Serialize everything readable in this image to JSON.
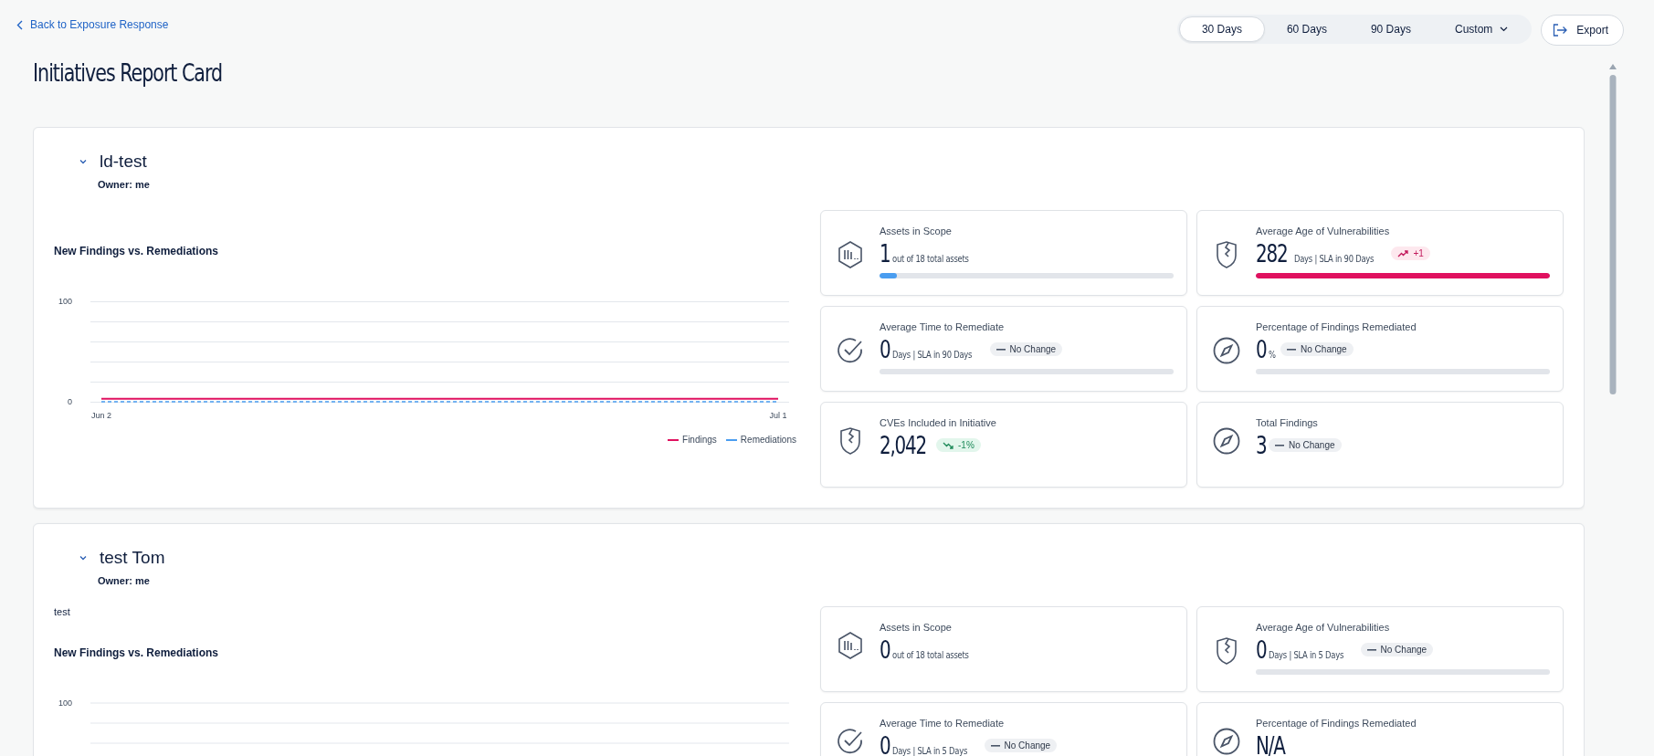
{
  "back_link": "Back to Exposure Response",
  "range_tabs": [
    {
      "label": "30 Days",
      "selected": true
    },
    {
      "label": "60 Days",
      "selected": false
    },
    {
      "label": "90 Days",
      "selected": false
    },
    {
      "label": "Custom",
      "selected": false,
      "kind": "dropdown"
    }
  ],
  "export_button": "Export",
  "title": "Initiatives Report Card",
  "initiatives": [
    {
      "name": "ld-test",
      "expanded": true,
      "owner": "Owner: me",
      "chart": {
        "title": "New Findings vs. Remediations",
        "chart_data": {
          "type": "line",
          "x": [
            "Jun 2",
            "Jul 1"
          ],
          "yticks": [
            {
              "value": 0,
              "label": "0"
            },
            {
              "value": 100,
              "label": "100"
            }
          ],
          "ylim": [
            0,
            100
          ],
          "series": [
            {
              "name": "Findings",
              "color": "#e0115f",
              "line_style": "solid",
              "values": [
                3,
                3
              ]
            },
            {
              "name": "Remediations",
              "color": "#4a9df0",
              "line_style": "dashed",
              "values": [
                0,
                0
              ]
            }
          ]
        }
      },
      "metrics": [
        {
          "kind": "assets",
          "label": "Assets in Scope",
          "value": "1",
          "unit": "out of 18 total assets",
          "level": 0.06,
          "over_sla": false
        },
        {
          "kind": "age",
          "label": "Average Age of Vulnerabilities",
          "value": "282",
          "unit": "Days | SLA in 90 Days",
          "badge": {
            "text": "+1",
            "kind": "up"
          },
          "level": 1,
          "over_sla": true
        },
        {
          "kind": "time",
          "label": "Average Time to Remediate",
          "value": "0",
          "unit": "Days | SLA in 90 Days",
          "badge": {
            "text": "No Change",
            "kind": "flat"
          },
          "level": 0
        },
        {
          "kind": "percent",
          "label": "Percentage of Findings Remediated",
          "value": "0",
          "unit": "%",
          "badge": {
            "text": "No Change",
            "kind": "flat"
          },
          "level": 0
        },
        {
          "kind": "cves",
          "label": "CVEs Included in Initiative",
          "value": "2,042",
          "badge": {
            "text": "-1%",
            "kind": "down"
          }
        },
        {
          "kind": "total",
          "label": "Total Findings",
          "value": "3",
          "badge": {
            "text": "No Change",
            "kind": "flat"
          }
        }
      ]
    },
    {
      "name": "test Tom",
      "expanded": true,
      "owner": "Owner: me",
      "description": "test",
      "chart": {
        "title": "New Findings vs. Remediations",
        "tick_labels": [
          "100"
        ]
      },
      "metrics": [
        {
          "kind": "assets",
          "label": "Assets in Scope",
          "value": "0",
          "unit": "out of 18 total assets"
        },
        {
          "kind": "age",
          "label": "Average Age of Vulnerabilities",
          "value": "0",
          "unit": "Days | SLA in 5 Days",
          "badge": {
            "text": "No Change",
            "kind": "flat"
          },
          "level": 0
        },
        {
          "kind": "time",
          "label": "Average Time to Remediate",
          "value": "0",
          "unit": "Days | SLA in 5 Days",
          "badge": {
            "text": "No Change",
            "kind": "flat"
          }
        },
        {
          "kind": "percent",
          "label": "Percentage of Findings Remediated",
          "value": "N/A"
        }
      ]
    }
  ]
}
